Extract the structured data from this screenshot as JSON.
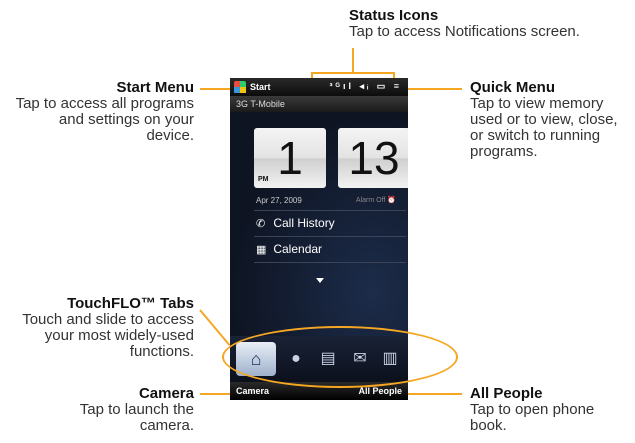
{
  "callouts": {
    "status_icons": {
      "title": "Status Icons",
      "desc": "Tap to access Notifications screen."
    },
    "start_menu": {
      "title": "Start Menu",
      "desc": "Tap to access all programs and settings on your device."
    },
    "quick_menu": {
      "title": "Quick Menu",
      "desc": "Tap to view memory used or to view, close, or switch to running programs."
    },
    "touchflo": {
      "title": "TouchFLO™ Tabs",
      "desc": "Touch and slide to access your most widely-used functions."
    },
    "camera": {
      "title": "Camera",
      "desc": "Tap to launch the camera."
    },
    "all_people": {
      "title": "All People",
      "desc": "Tap to open phone book."
    }
  },
  "phone": {
    "start_label": "Start",
    "status_icons_text": "³ᴳıl ◂ᵢ ▭ ≡",
    "carrier": "3G T-Mobile",
    "clock": {
      "hour": "1",
      "minute": "13",
      "ampm": "PM"
    },
    "date": "Apr 27, 2009",
    "alarm": "Alarm Off ⏰",
    "items": [
      {
        "icon": "phone-icon",
        "glyph": "✆",
        "label": "Call History"
      },
      {
        "icon": "calendar-icon",
        "glyph": "▦",
        "label": "Calendar"
      }
    ],
    "tabs": [
      {
        "name": "home",
        "glyph": "⌂"
      },
      {
        "name": "people",
        "glyph": "●"
      },
      {
        "name": "messages",
        "glyph": "▤"
      },
      {
        "name": "email",
        "glyph": "✉"
      },
      {
        "name": "calendar",
        "glyph": "▥"
      }
    ],
    "softkeys": {
      "left": "Camera",
      "right": "All People"
    }
  }
}
